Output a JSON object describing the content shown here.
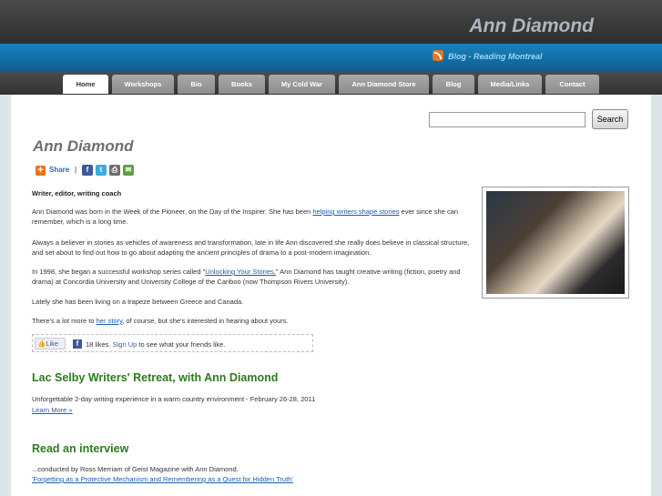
{
  "header": {
    "site_title": "Ann Diamond",
    "blog_link": "Blog - Reading Montreal"
  },
  "nav": {
    "tabs": [
      {
        "label": "Home",
        "active": true
      },
      {
        "label": "Workshops",
        "active": false
      },
      {
        "label": "Bio",
        "active": false
      },
      {
        "label": "Books",
        "active": false
      },
      {
        "label": "My Cold War",
        "active": false
      },
      {
        "label": "Ann Diamond Store",
        "active": false
      },
      {
        "label": "Blog",
        "active": false
      },
      {
        "label": "Media/Links",
        "active": false
      },
      {
        "label": "Contact",
        "active": false
      }
    ]
  },
  "search": {
    "placeholder": "",
    "button_label": "Search"
  },
  "main": {
    "page_title": "Ann Diamond",
    "share_label": "Share",
    "share_separator": "|",
    "tagline": "Writer, editor, writing coach",
    "p1_before": "Ann Diamond was born in the Week of the Pioneer, on the Day of the Inspirer. She has been ",
    "p1_link": "helping writers shape stories",
    "p1_after": " ever since she can remember, which is a long time.",
    "p2": "Always a believer in stories as vehicles of awareness and transformation, late in life Ann discovered she really does believe in classical structure, and set about to find out how to go about adapting the ancient principles of drama to a post-modern imagination.",
    "p3_before": " In 1998, she began a successful workshop series called \"",
    "p3_link": "Unlocking Your Stories,",
    "p3_after": "\" Ann Diamond has taught creative writing (fiction, poetry and drama) at Concordia University and University College of the Cariboo (now Thompson Rivers University).",
    "p4": "Lately she has been living on a trapeze between Greece and Canada.",
    "p5_before": "There's a lot more to ",
    "p5_link": "her story",
    "p5_after": ", of course, but she's interested in hearing about yours."
  },
  "facebook": {
    "like_label": "Like",
    "count_text": "18 likes.",
    "signup_link": "Sign Up",
    "signup_after": " to see what your friends like."
  },
  "sections": {
    "retreat_title": "Lac Selby Writers' Retreat, with Ann Diamond",
    "retreat_text": "Unforgettable 2-day writing experience in a warm country environment - February 26-28, 2011",
    "retreat_link": "Learn More »",
    "interview_title": "Read an interview",
    "interview_text": "...conducted by Ross Merriam of Geist Magazine with Ann Diamond.",
    "interview_link": "'Forgetting as a Protective Mechanism and Remembering as a Quest for Hidden Truth'"
  },
  "colors": {
    "accent_blue": "#1a82bc",
    "heading_green": "#2d7a1f",
    "link_blue": "#1a5ea8"
  }
}
